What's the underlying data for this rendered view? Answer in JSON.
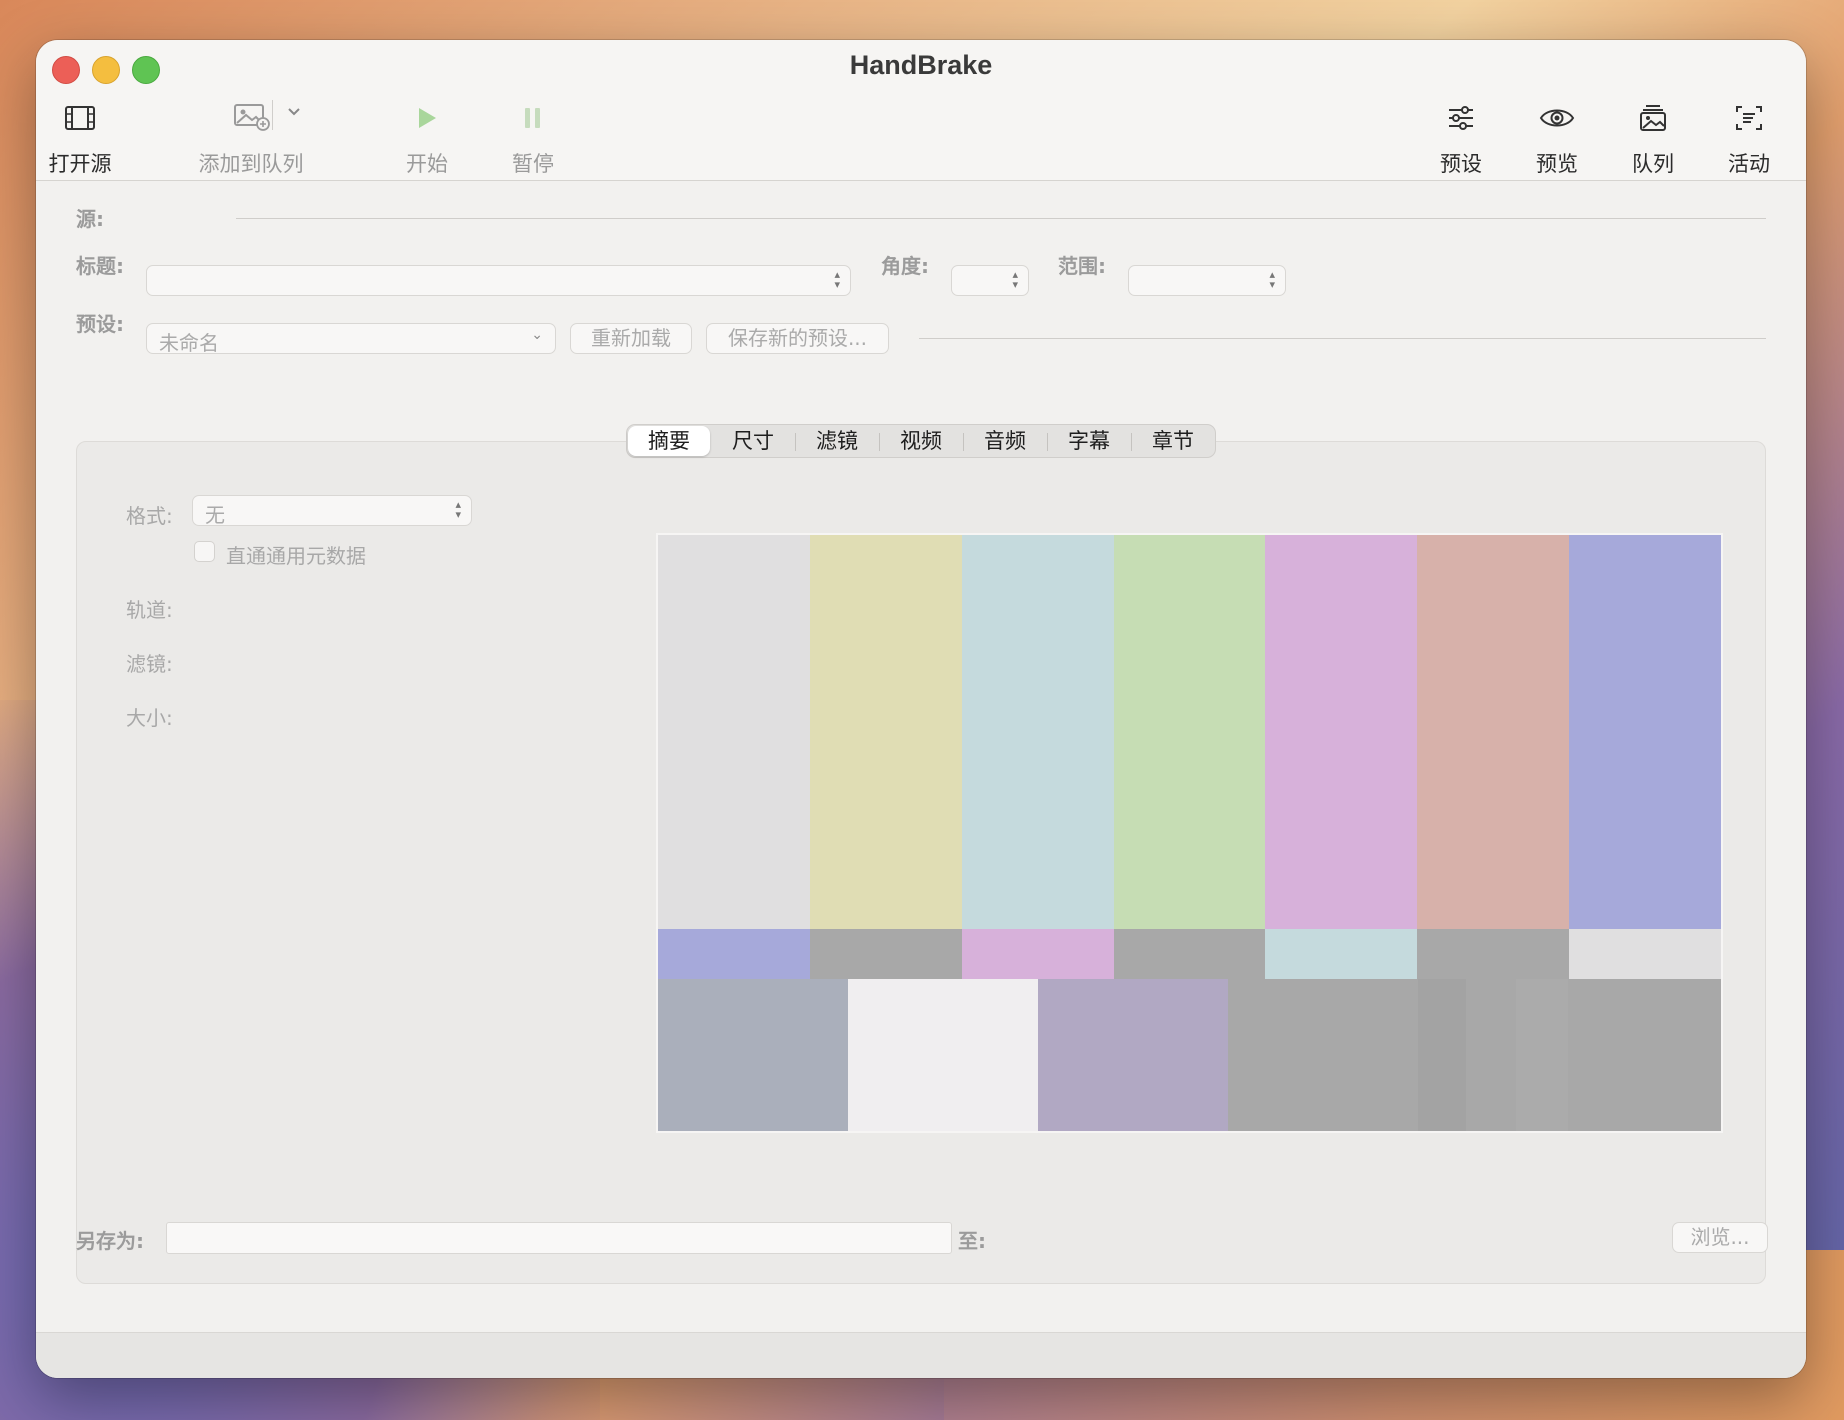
{
  "window": {
    "title": "HandBrake"
  },
  "toolbar": {
    "open_source": "打开源",
    "add_to_queue": "添加到队列",
    "start": "开始",
    "pause": "暂停",
    "presets": "预设",
    "preview": "预览",
    "queue": "队列",
    "activity": "活动"
  },
  "source": {
    "label": "源:"
  },
  "title_row": {
    "label": "标题:",
    "angle_label": "角度:",
    "range_label": "范围:"
  },
  "preset_row": {
    "label": "预设:",
    "value": "未命名",
    "reload_button": "重新加载",
    "save_new_button": "保存新的预设..."
  },
  "tabs": [
    {
      "label": "摘要",
      "selected": true
    },
    {
      "label": "尺寸"
    },
    {
      "label": "滤镜"
    },
    {
      "label": "视频"
    },
    {
      "label": "音频"
    },
    {
      "label": "字幕"
    },
    {
      "label": "章节"
    }
  ],
  "summary": {
    "format_label": "格式:",
    "format_value": "无",
    "passthru_metadata": "直通通用元数据",
    "tracks_label": "轨道:",
    "filters_label": "滤镜:",
    "size_label": "大小:"
  },
  "preview_bars": {
    "top": [
      "#e0dfe0",
      "#e0ddb4",
      "#c5dadd",
      "#c6ddb4",
      "#d7b1da",
      "#d7b1aa",
      "#a6a9da"
    ],
    "middle": [
      "#a6a9da",
      "#a8a8a8",
      "#d7b1da",
      "#a8a8a8",
      "#c5dadd",
      "#a8a8a8",
      "#e0dfe0"
    ],
    "bottom": [
      "#aaafbb",
      "#f0eef0",
      "#b1a8c3",
      "#a8a8a8",
      "#a3a3a3",
      "#a8a8a8",
      "#ababab",
      "#a8a8a8"
    ]
  },
  "output": {
    "save_as_label": "另存为:",
    "to_label": "至:",
    "browse_button": "浏览..."
  }
}
